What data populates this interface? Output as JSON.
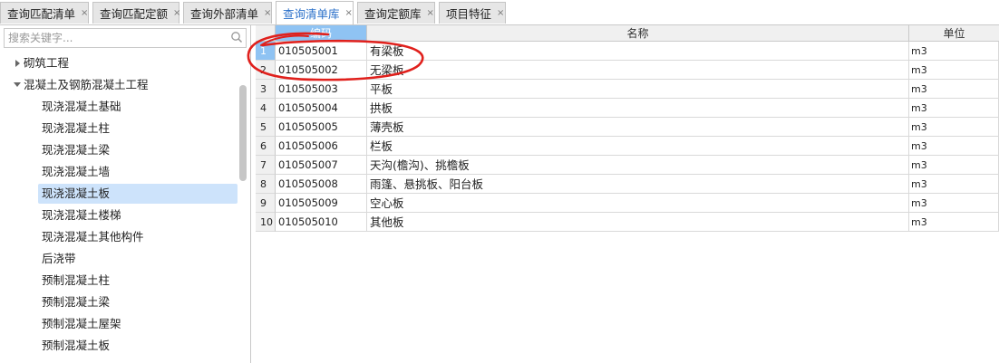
{
  "tabs": [
    {
      "label": "查询匹配清单",
      "close": "×"
    },
    {
      "label": "查询匹配定额",
      "close": "×"
    },
    {
      "label": "查询外部清单",
      "close": "×"
    },
    {
      "label": "查询清单库",
      "close": "×",
      "active": true
    },
    {
      "label": "查询定额库",
      "close": "×"
    },
    {
      "label": "项目特征",
      "close": "×"
    }
  ],
  "search": {
    "placeholder": "搜索关键字..."
  },
  "tree": [
    {
      "label": "砌筑工程",
      "state": "collapsed"
    },
    {
      "label": "混凝土及钢筋混凝土工程",
      "state": "expanded"
    },
    {
      "label": "现浇混凝土基础"
    },
    {
      "label": "现浇混凝土柱"
    },
    {
      "label": "现浇混凝土梁"
    },
    {
      "label": "现浇混凝土墙"
    },
    {
      "label": "现浇混凝土板",
      "selected": true
    },
    {
      "label": "现浇混凝土楼梯"
    },
    {
      "label": "现浇混凝土其他构件"
    },
    {
      "label": "后浇带"
    },
    {
      "label": "预制混凝土柱"
    },
    {
      "label": "预制混凝土梁"
    },
    {
      "label": "预制混凝土屋架"
    },
    {
      "label": "预制混凝土板"
    }
  ],
  "grid": {
    "headers": {
      "code": "编码",
      "name": "名称",
      "unit": "单位"
    },
    "rows": [
      {
        "n": "1",
        "code": "010505001",
        "name": "有梁板",
        "unit": "m3"
      },
      {
        "n": "2",
        "code": "010505002",
        "name": "无梁板",
        "unit": "m3"
      },
      {
        "n": "3",
        "code": "010505003",
        "name": "平板",
        "unit": "m3"
      },
      {
        "n": "4",
        "code": "010505004",
        "name": "拱板",
        "unit": "m3"
      },
      {
        "n": "5",
        "code": "010505005",
        "name": "薄壳板",
        "unit": "m3"
      },
      {
        "n": "6",
        "code": "010505006",
        "name": "栏板",
        "unit": "m3"
      },
      {
        "n": "7",
        "code": "010505007",
        "name": "天沟(檐沟)、挑檐板",
        "unit": "m3"
      },
      {
        "n": "8",
        "code": "010505008",
        "name": "雨篷、悬挑板、阳台板",
        "unit": "m3"
      },
      {
        "n": "9",
        "code": "010505009",
        "name": "空心板",
        "unit": "m3"
      },
      {
        "n": "10",
        "code": "010505010",
        "name": "其他板",
        "unit": "m3"
      }
    ]
  },
  "colors": {
    "accent": "#2a6fc9",
    "selection": "#cde3fb",
    "header_selected": "#8fc3f3",
    "annotation": "#e0201c"
  },
  "icons": {
    "search": "magnifier-icon",
    "collapsed": "triangle-right-icon",
    "expanded": "triangle-down-icon",
    "close": "close-icon"
  }
}
